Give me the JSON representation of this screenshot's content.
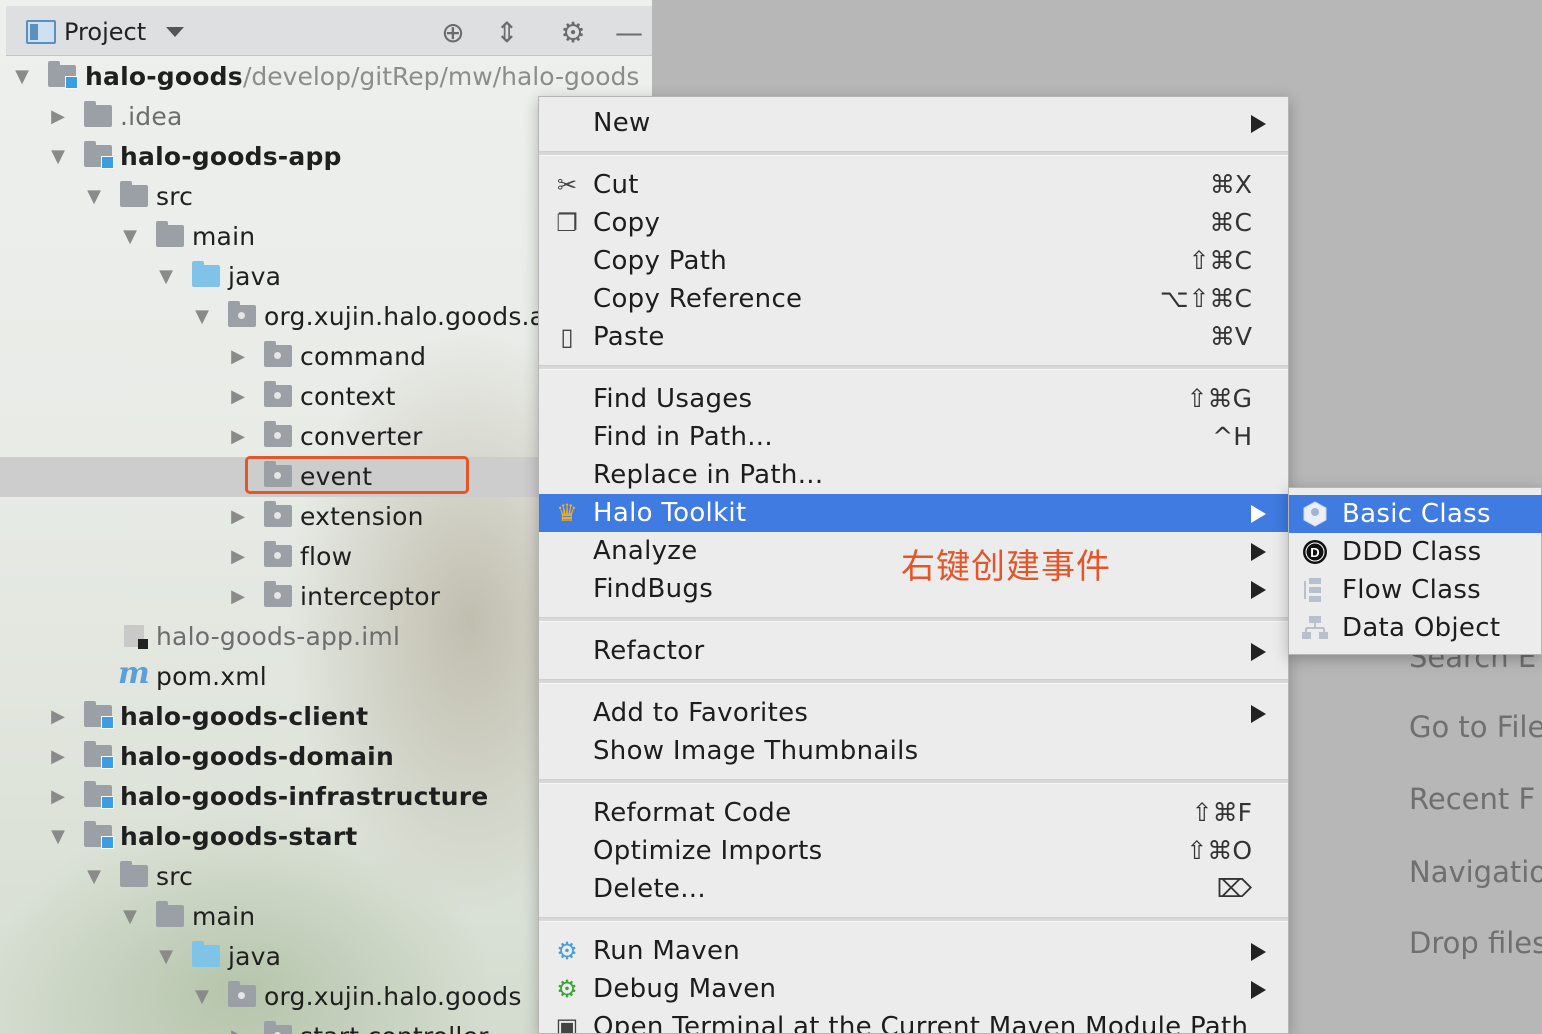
{
  "project_panel": {
    "title": "Project",
    "root": {
      "name": "halo-goods",
      "path": "/develop/gitRep/mw/halo-goods"
    },
    "tree": [
      {
        "label": ".idea",
        "bold": false
      },
      {
        "label": "halo-goods-app",
        "bold": true
      },
      {
        "label": "src"
      },
      {
        "label": "main"
      },
      {
        "label": "java"
      },
      {
        "label": "org.xujin.halo.goods.a"
      },
      {
        "label": "command"
      },
      {
        "label": "context"
      },
      {
        "label": "converter"
      },
      {
        "label": "event"
      },
      {
        "label": "extension"
      },
      {
        "label": "flow"
      },
      {
        "label": "interceptor"
      },
      {
        "label": "halo-goods-app.iml"
      },
      {
        "label": "pom.xml"
      },
      {
        "label": "halo-goods-client",
        "bold": true
      },
      {
        "label": "halo-goods-domain",
        "bold": true
      },
      {
        "label": "halo-goods-infrastructure",
        "bold": true
      },
      {
        "label": "halo-goods-start",
        "bold": true
      },
      {
        "label": "src"
      },
      {
        "label": "main"
      },
      {
        "label": "java"
      },
      {
        "label": "org.xujin.halo.goods"
      },
      {
        "label": "start.controller"
      }
    ]
  },
  "context_menu": {
    "items": [
      {
        "label": "New",
        "shortcut": "",
        "submenu": true
      },
      {
        "label": "Cut",
        "shortcut": "⌘X",
        "icon": "scissors-icon"
      },
      {
        "label": "Copy",
        "shortcut": "⌘C",
        "icon": "copy-icon"
      },
      {
        "label": "Copy Path",
        "shortcut": "⇧⌘C"
      },
      {
        "label": "Copy Reference",
        "shortcut": "⌥⇧⌘C"
      },
      {
        "label": "Paste",
        "shortcut": "⌘V",
        "icon": "clipboard-icon"
      },
      {
        "label": "Find Usages",
        "shortcut": "⇧⌘G"
      },
      {
        "label": "Find in Path...",
        "shortcut": "^H"
      },
      {
        "label": "Replace in Path...",
        "shortcut": ""
      },
      {
        "label": "Halo Toolkit",
        "shortcut": "",
        "submenu": true,
        "icon": "crown-icon",
        "active": true
      },
      {
        "label": "Analyze",
        "shortcut": "",
        "submenu": true
      },
      {
        "label": "FindBugs",
        "shortcut": "",
        "submenu": true
      },
      {
        "label": "Refactor",
        "shortcut": "",
        "submenu": true
      },
      {
        "label": "Add to Favorites",
        "shortcut": "",
        "submenu": true
      },
      {
        "label": "Show Image Thumbnails",
        "shortcut": ""
      },
      {
        "label": "Reformat Code",
        "shortcut": "⇧⌘F"
      },
      {
        "label": "Optimize Imports",
        "shortcut": "⇧⌘O"
      },
      {
        "label": "Delete...",
        "shortcut": "⌦"
      },
      {
        "label": "Run Maven",
        "shortcut": "",
        "submenu": true,
        "icon": "gear-icon"
      },
      {
        "label": "Debug Maven",
        "shortcut": "",
        "submenu": true,
        "icon": "gear-green-icon"
      },
      {
        "label": "Open Terminal at the Current Maven Module Path",
        "shortcut": "",
        "icon": "terminal-icon"
      }
    ]
  },
  "annotation": "右键创建事件",
  "submenu": {
    "items": [
      {
        "label": "Basic Class",
        "active": true
      },
      {
        "label": "DDD Class"
      },
      {
        "label": "Flow Class"
      },
      {
        "label": "Data Object"
      }
    ]
  },
  "welcome_hints": [
    "Search E",
    "Go to File",
    "Recent F",
    "Navigatio",
    "Drop files"
  ],
  "colors": {
    "selection": "#3f7be0",
    "annotation": "#e4552a",
    "module_badge": "#3a9ee0"
  }
}
